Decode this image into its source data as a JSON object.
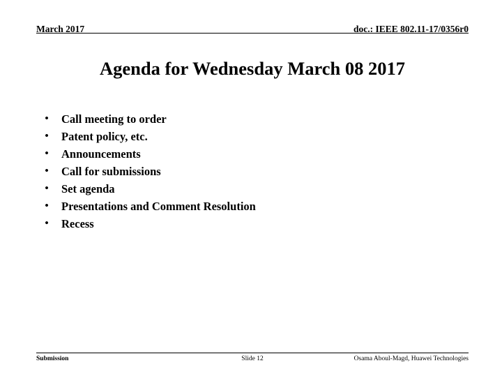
{
  "slide": {
    "header": {
      "left_text": "March 2017",
      "right_text": "doc.: IEEE 802.11-17/0356r0"
    },
    "title": "Agenda for Wednesday March 08 2017",
    "bullets": [
      {
        "marker": "•",
        "text": "Call meeting to order"
      },
      {
        "marker": "•",
        "text": "Patent policy, etc."
      },
      {
        "marker": "•",
        "text": "Announcements"
      },
      {
        "marker": "•",
        "text": "Call for submissions"
      },
      {
        "marker": "•",
        "text": "Set agenda"
      },
      {
        "marker": "•",
        "text": "Presentations and Comment Resolution"
      },
      {
        "marker": "•",
        "text": "Recess"
      }
    ],
    "footer": {
      "left_text": "Submission",
      "center_text": "Slide 12",
      "right_text": "Osama Aboul-Magd, Huawei Technologies"
    },
    "colors": {
      "text": "#000000",
      "background": "#ffffff",
      "rule": "#000000"
    }
  }
}
